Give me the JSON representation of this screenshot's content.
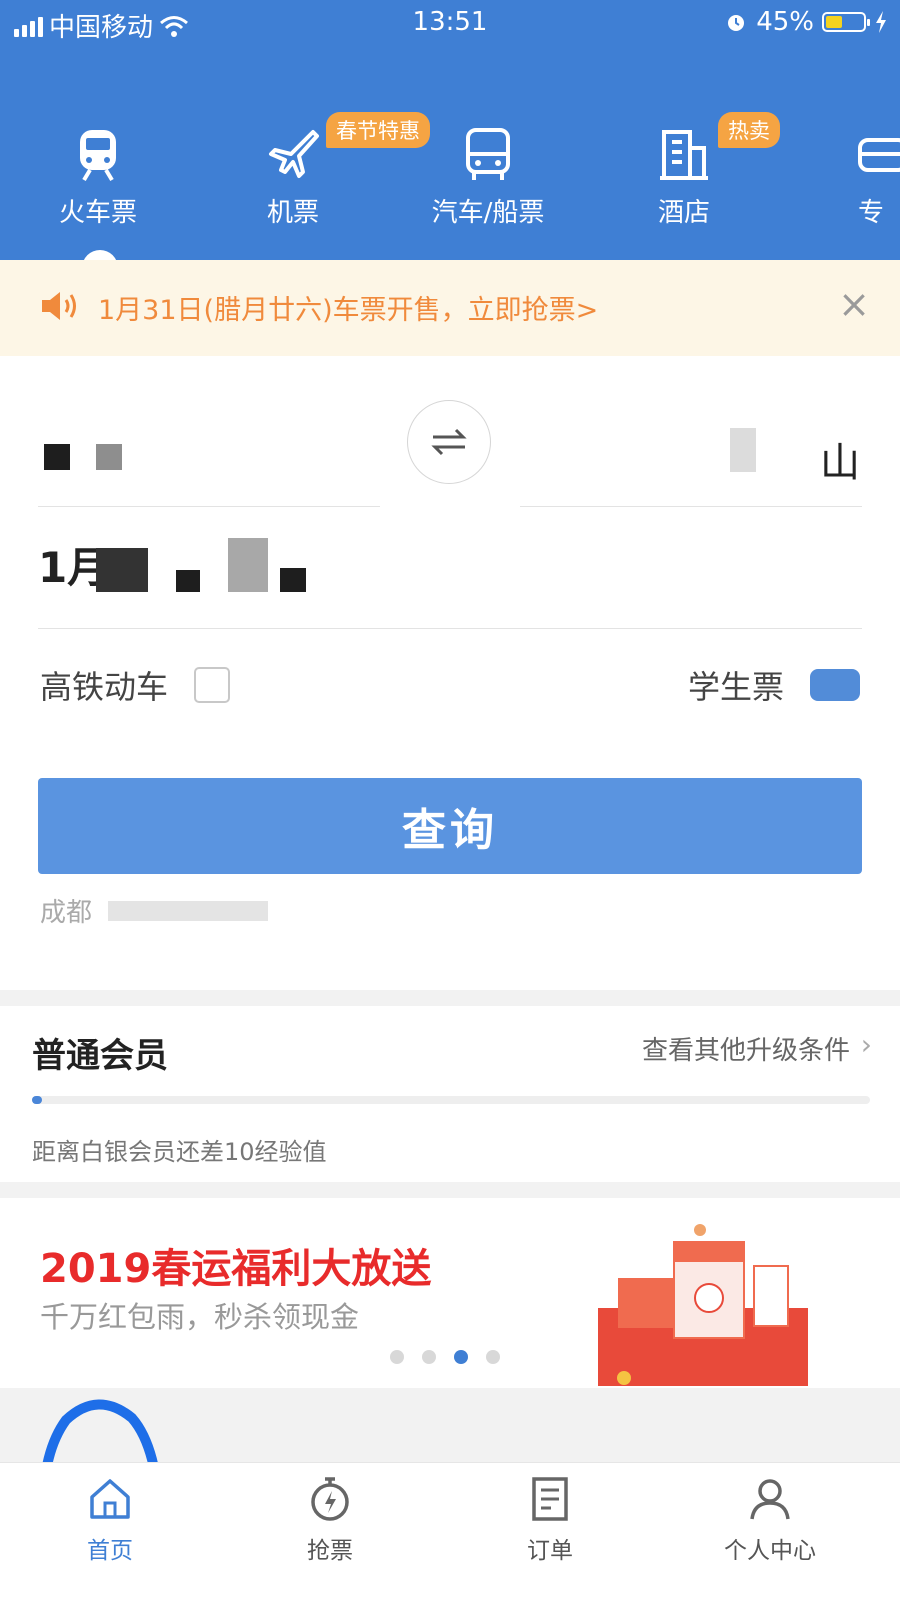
{
  "status_bar": {
    "carrier": "中国移动",
    "time": "13:51",
    "battery": "45%",
    "battery_level": 0.45
  },
  "nav": {
    "items": [
      {
        "label": "火车票",
        "icon": "train-icon",
        "active": true
      },
      {
        "label": "机票",
        "icon": "plane-icon",
        "badge": "春节特惠"
      },
      {
        "label": "汽车/船票",
        "icon": "bus-icon"
      },
      {
        "label": "酒店",
        "icon": "hotel-icon",
        "badge": "热卖"
      },
      {
        "label": "专",
        "icon": "car-icon"
      }
    ]
  },
  "notice": {
    "text": "1月31日(腊月廿六)车票开售，立即抢票>",
    "icon": "speaker-icon",
    "close": "×"
  },
  "search": {
    "from_city": "",
    "to_city": "山",
    "date": "1月",
    "highspeed_label": "高铁动车",
    "student_label": "学生票",
    "query_label": "查询",
    "history": "成都"
  },
  "member": {
    "title": "普通会员",
    "link": "查看其他升级条件",
    "hint": "距离白银会员还差10经验值",
    "progress": 0.01
  },
  "banner": {
    "title": "2019春运福利大放送",
    "subtitle": "千万红包雨，秒杀领现金",
    "dots": 4,
    "active_dot": 2
  },
  "tabbar": {
    "items": [
      {
        "label": "首页",
        "icon": "home-icon",
        "active": true
      },
      {
        "label": "抢票",
        "icon": "stopwatch-icon"
      },
      {
        "label": "订单",
        "icon": "order-icon"
      },
      {
        "label": "个人中心",
        "icon": "user-icon"
      }
    ]
  },
  "colors": {
    "header": "#3f7fd4",
    "notice_bg": "#fdf6e6",
    "notice_text": "#f08a3c",
    "button": "#5a94e0",
    "badge": "#f5a443",
    "banner_title": "#e82b2b"
  }
}
